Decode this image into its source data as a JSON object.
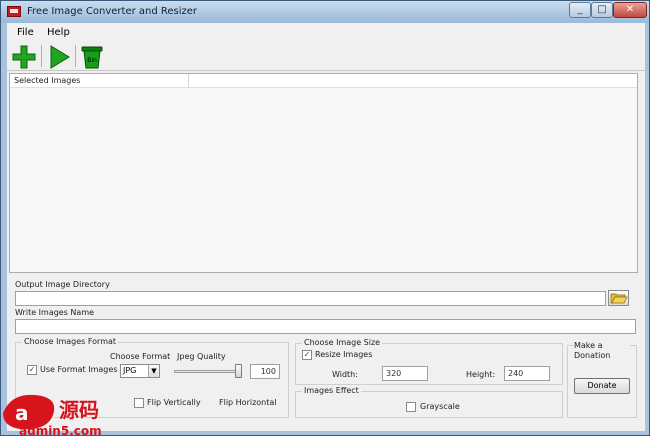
{
  "window": {
    "title": "Free Image Converter and Resizer"
  },
  "menu": {
    "file": "File",
    "help": "Help"
  },
  "toolbar": {
    "add_icon": "plus-icon",
    "start_icon": "play-icon",
    "bin_icon": "bin-icon",
    "bin_label": "Bin"
  },
  "list": {
    "column_selected_images": "Selected Images"
  },
  "output": {
    "directory_label": "Output Image Directory",
    "directory_value": ""
  },
  "write_name": {
    "label": "Write Images Name",
    "value": ""
  },
  "format": {
    "group_title": "Choose Images Format",
    "choose_format_label": "Choose Format",
    "jpeg_quality_label": "Jpeg Quality",
    "use_format_label": "Use Format Images",
    "use_format_checked": true,
    "format_value": "JPG",
    "quality_value": "100",
    "quality_fraction": 1.0
  },
  "flip": {
    "vertical_label": "Flip Vertically",
    "horizontal_label": "Flip Horizontal"
  },
  "size": {
    "group_title": "Choose Image Size",
    "resize_label": "Resize Images",
    "resize_checked": true,
    "width_label": "Width:",
    "width_value": "320",
    "height_label": "Height:",
    "height_value": "240"
  },
  "effect": {
    "group_title": "Images Effect",
    "grayscale_label": "Grayscale"
  },
  "donation": {
    "title": "Make a Donation",
    "button_label": "Donate"
  },
  "watermark": {
    "brand": "a5源码",
    "site": "admin5.com"
  },
  "colors": {
    "accent_green": "#1fa51f",
    "bin_green": "#0e7d10",
    "watermark_red": "#d6141c"
  }
}
